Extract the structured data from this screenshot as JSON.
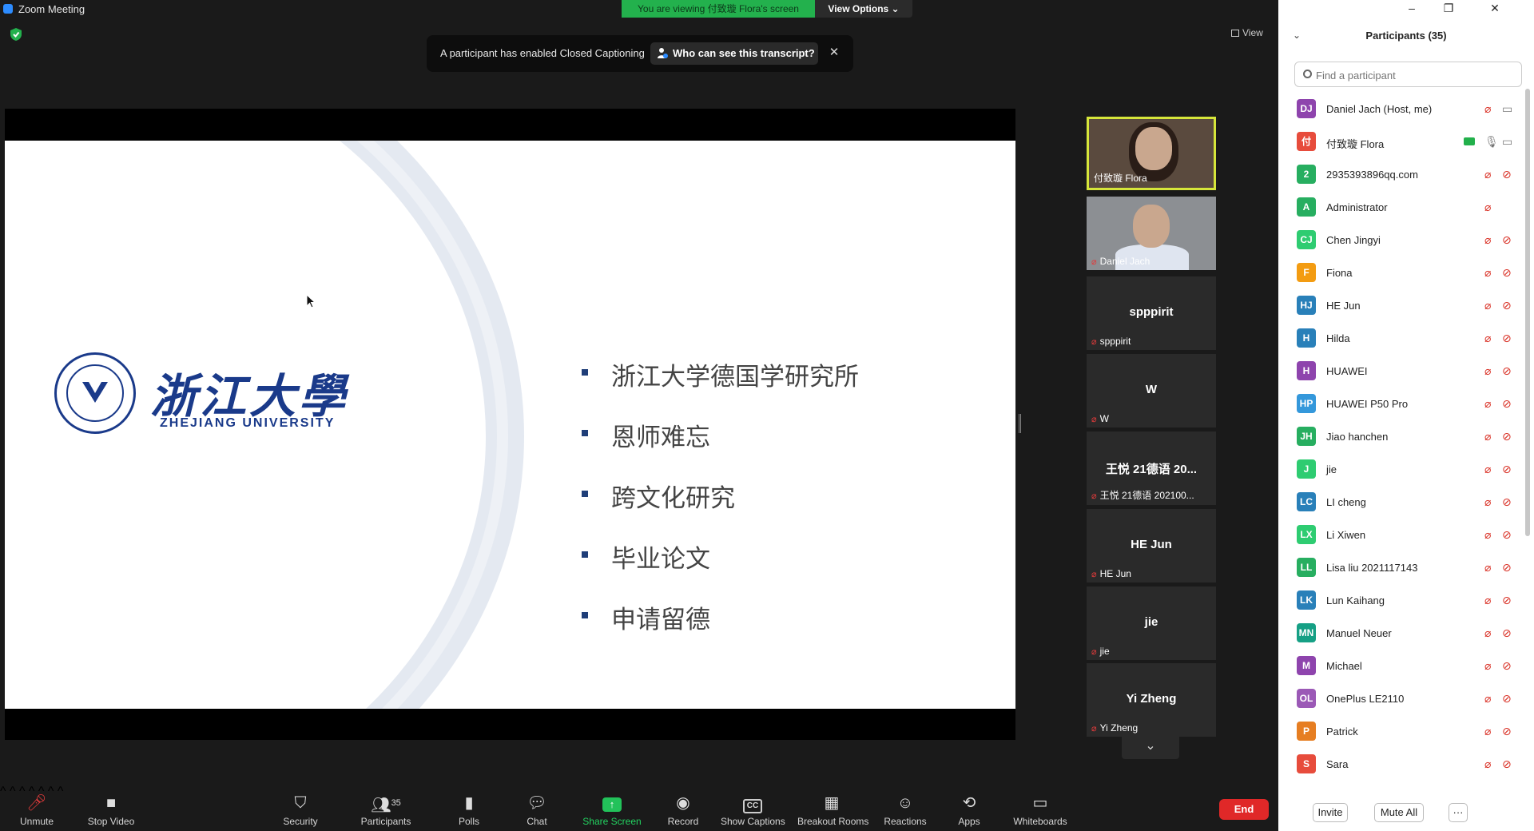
{
  "window": {
    "title": "Zoom Meeting",
    "minimize": "–",
    "maximize": "❐",
    "close": "✕"
  },
  "banner": {
    "viewing": "You are viewing 付致璇 Flora's screen",
    "view_options": "View Options ⌄"
  },
  "notice": {
    "text": "A participant has enabled Closed Captioning",
    "button": "Who can see this transcript?",
    "close": "✕"
  },
  "view_button": "View",
  "slide": {
    "logo_cn": "浙江大學",
    "logo_en": "ZHEJIANG UNIVERSITY",
    "bullets": [
      "浙江大学德国学研究所",
      "恩师难忘",
      "跨文化研究",
      "毕业论文",
      "申请留德"
    ],
    "nav": [
      "←",
      "✎",
      "▣",
      "⋯",
      "→"
    ]
  },
  "gallery": [
    {
      "label": "付致璇 Flora",
      "type": "video"
    },
    {
      "label": "Daniel Jach",
      "type": "video"
    },
    {
      "name": "spppirit",
      "label": "spppirit"
    },
    {
      "name": "W",
      "label": "W"
    },
    {
      "name": "王悦 21德语 20...",
      "label": "王悦 21德语 202100..."
    },
    {
      "name": "HE Jun",
      "label": "HE Jun"
    },
    {
      "name": "jie",
      "label": "jie"
    },
    {
      "name": "Yi Zheng",
      "label": "Yi Zheng"
    }
  ],
  "gallery_down": "⌄",
  "toolbar": {
    "unmute": "Unmute",
    "stop_video": "Stop Video",
    "security": "Security",
    "participants": "Participants",
    "participants_count": "35",
    "polls": "Polls",
    "chat": "Chat",
    "share_screen": "Share Screen",
    "record": "Record",
    "show_captions": "Show Captions",
    "captions_icon": "CC",
    "breakout_rooms": "Breakout Rooms",
    "reactions": "Reactions",
    "apps": "Apps",
    "whiteboards": "Whiteboards",
    "end": "End"
  },
  "panel": {
    "title": "Participants (35)",
    "search_placeholder": "Find a participant",
    "participants": [
      {
        "initials": "DJ",
        "name": "Daniel Jach (Host, me)",
        "color": "#8e44ad",
        "cam_on": true
      },
      {
        "initials": "付",
        "name": "付致璇 Flora",
        "color": "#e74c3c",
        "cam_on": true,
        "mic_on": true,
        "sharing": true
      },
      {
        "initials": "2",
        "name": "2935393896qq.com",
        "color": "#27ae60"
      },
      {
        "initials": "A",
        "name": "Administrator",
        "color": "#27ae60",
        "no_cam": true
      },
      {
        "initials": "CJ",
        "name": "Chen Jingyi",
        "color": "#2ecc71"
      },
      {
        "initials": "F",
        "name": "Fiona",
        "color": "#f39c12"
      },
      {
        "initials": "HJ",
        "name": "HE Jun",
        "color": "#2980b9"
      },
      {
        "initials": "H",
        "name": "Hilda",
        "color": "#2980b9"
      },
      {
        "initials": "H",
        "name": "HUAWEI",
        "color": "#8e44ad"
      },
      {
        "initials": "HP",
        "name": "HUAWEI P50 Pro",
        "color": "#3498db"
      },
      {
        "initials": "JH",
        "name": "Jiao hanchen",
        "color": "#27ae60"
      },
      {
        "initials": "J",
        "name": "jie",
        "color": "#2ecc71"
      },
      {
        "initials": "LC",
        "name": "LI cheng",
        "color": "#2980b9"
      },
      {
        "initials": "LX",
        "name": "Li Xiwen",
        "color": "#2ecc71"
      },
      {
        "initials": "LL",
        "name": "Lisa liu 2021117143",
        "color": "#27ae60"
      },
      {
        "initials": "LK",
        "name": "Lun Kaihang",
        "color": "#2980b9"
      },
      {
        "initials": "MN",
        "name": "Manuel Neuer",
        "color": "#16a085"
      },
      {
        "initials": "M",
        "name": "Michael",
        "color": "#8e44ad"
      },
      {
        "initials": "OL",
        "name": "OnePlus LE2110",
        "color": "#9b59b6"
      },
      {
        "initials": "P",
        "name": "Patrick",
        "color": "#e67e22"
      },
      {
        "initials": "S",
        "name": "Sara",
        "color": "#e74c3c"
      }
    ],
    "invite": "Invite",
    "mute_all": "Mute All",
    "more": "···"
  }
}
